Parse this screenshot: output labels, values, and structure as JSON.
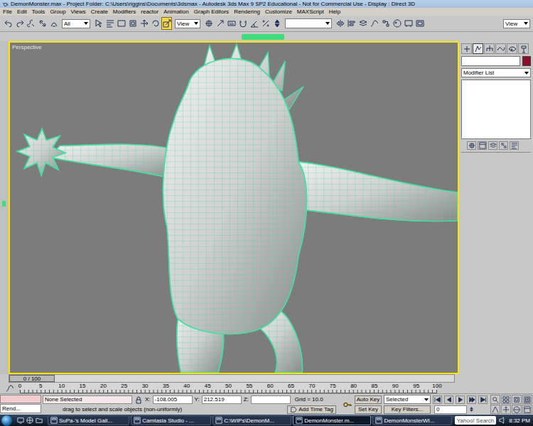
{
  "window": {
    "title": "DemonMonster.max - Project Folder: C:\\Users\\riggins\\Documents\\3dsmax - Autodesk 3ds Max 9 SP2 Educational - Not for Commercial Use - Display : Direct 3D"
  },
  "menu": [
    "File",
    "Edit",
    "Tools",
    "Group",
    "Views",
    "Create",
    "Modifiers",
    "reactor",
    "Animation",
    "Graph Editors",
    "Rendering",
    "Customize",
    "MAXScript",
    "Help"
  ],
  "toolbar": {
    "selection_filter": "All",
    "reference_coord": "View",
    "render_view": "View",
    "transform_tools": [
      {
        "selected": false
      },
      {
        "selected": false
      },
      {
        "selected": true
      }
    ]
  },
  "viewport": {
    "label": "Perspective",
    "active": true
  },
  "command_panel": {
    "tabs": [
      {
        "selected": false
      },
      {
        "selected": true
      },
      {
        "selected": false
      },
      {
        "selected": false
      },
      {
        "selected": false
      },
      {
        "selected": false
      }
    ],
    "modifier_list": "Modifier List"
  },
  "time_slider": {
    "frame": "0 / 100",
    "level": 0
  },
  "track_bar": {
    "ticks": [
      "0",
      "5",
      "10",
      "15",
      "20",
      "25",
      "30",
      "35",
      "40",
      "45",
      "50",
      "55",
      "60",
      "65",
      "70",
      "75",
      "80",
      "85",
      "90",
      "95",
      "100"
    ]
  },
  "status_bar": {
    "maxscript": "Rend...",
    "selection": "None Selected",
    "prompt": "drag to select and scale objects (non-uniformly)",
    "x_label": "X:",
    "x": "-108.005",
    "y_label": "Y:",
    "y": "212.519",
    "z_label": "Z:",
    "z": "",
    "grid": "Grid = 10.0",
    "add_time_tag": "Add Time Tag",
    "auto_key": {
      "label": "Auto Key",
      "on": false
    },
    "key_mode": "Selected",
    "set_key": "Set Key",
    "key_filters": "Key Filters...",
    "current_frame": "0"
  },
  "taskbar": {
    "buttons": [
      {
        "label": "SuPa-'s Model Gall...",
        "selected": false
      },
      {
        "label": "Camtasia Studio - ...",
        "selected": false
      },
      {
        "label": "C:\\WIPs\\DemonM...",
        "selected": false
      },
      {
        "label": "DemonMonster.m...",
        "selected": true
      },
      {
        "label": "DemonMonsterWI...",
        "selected": false
      }
    ],
    "search": "Yahoo! Search",
    "clock": "8:32 PM"
  }
}
